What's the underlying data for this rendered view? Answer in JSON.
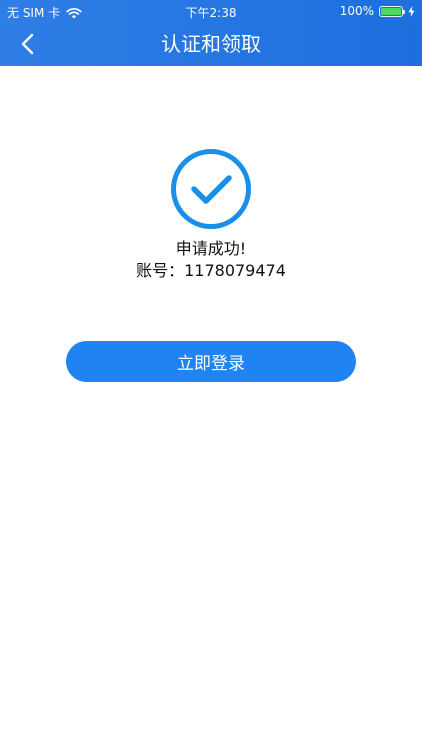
{
  "status_bar": {
    "carrier": "无 SIM 卡",
    "time": "下午2:38",
    "battery": "100%",
    "battery_level": 1.0,
    "icons": [
      "wifi-icon",
      "battery-icon",
      "charging-icon"
    ]
  },
  "nav": {
    "title": "认证和领取",
    "back_icon": "chevron-left-icon"
  },
  "result": {
    "icon": "check-circle-icon",
    "message": "申请成功!",
    "account": "账号：1178079474"
  },
  "actions": {
    "login_label": "立即登录"
  },
  "colors": {
    "header": "#2577e3",
    "accent": "#1f83f2",
    "icon": "#1a8fe8",
    "text": "#111111",
    "background": "#ffffff",
    "battery_fill": "#4cd964"
  }
}
